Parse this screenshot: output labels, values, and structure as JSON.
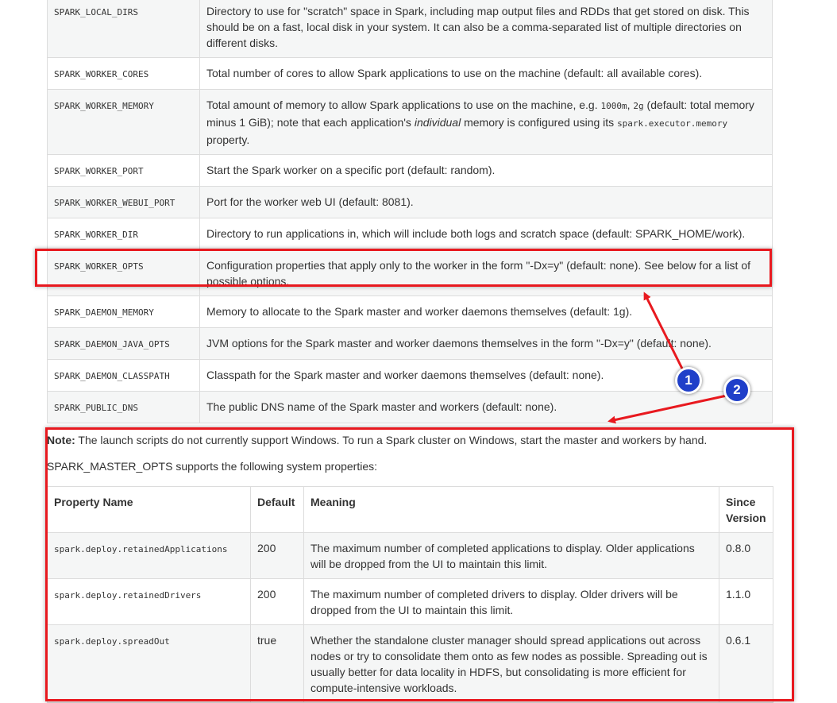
{
  "env_rows": [
    {
      "name": "SPARK_LOCAL_DIRS",
      "desc": [
        "Directory to use for \"scratch\" space in Spark, including map output files and RDDs that get stored on disk. This should be on a fast, local disk in your system. It can also be a comma-separated list of multiple directories on different disks."
      ]
    },
    {
      "name": "SPARK_WORKER_CORES",
      "desc": [
        "Total number of cores to allow Spark applications to use on the machine (default: all available cores)."
      ]
    },
    {
      "name": "SPARK_WORKER_MEMORY",
      "desc_parts": {
        "a": "Total amount of memory to allow Spark applications to use on the machine, e.g. ",
        "code1": "1000m",
        "b": ", ",
        "code2": "2g",
        "c": " (default: total memory minus 1 GiB); note that each application's ",
        "em": "individual",
        "d": " memory is configured using its ",
        "code3": "spark.executor.memory",
        "e": " property."
      }
    },
    {
      "name": "SPARK_WORKER_PORT",
      "desc": [
        "Start the Spark worker on a specific port (default: random)."
      ]
    },
    {
      "name": "SPARK_WORKER_WEBUI_PORT",
      "desc": [
        "Port for the worker web UI (default: 8081)."
      ]
    },
    {
      "name": "SPARK_WORKER_DIR",
      "desc": [
        "Directory to run applications in, which will include both logs and scratch space (default: SPARK_HOME/work)."
      ]
    },
    {
      "name": "SPARK_WORKER_OPTS",
      "desc": [
        "Configuration properties that apply only to the worker in the form \"-Dx=y\" (default: none). See below for a list of possible options."
      ]
    },
    {
      "name": "SPARK_DAEMON_MEMORY",
      "desc": [
        "Memory to allocate to the Spark master and worker daemons themselves (default: 1g)."
      ]
    },
    {
      "name": "SPARK_DAEMON_JAVA_OPTS",
      "desc": [
        "JVM options for the Spark master and worker daemons themselves in the form \"-Dx=y\" (default: none)."
      ]
    },
    {
      "name": "SPARK_DAEMON_CLASSPATH",
      "desc": [
        "Classpath for the Spark master and worker daemons themselves (default: none)."
      ]
    },
    {
      "name": "SPARK_PUBLIC_DNS",
      "desc": [
        "The public DNS name of the Spark master and workers (default: none)."
      ]
    }
  ],
  "note": {
    "label": "Note:",
    "text": " The launch scripts do not currently support Windows. To run a Spark cluster on Windows, start the master and workers by hand."
  },
  "master_opts_intro": "SPARK_MASTER_OPTS supports the following system properties:",
  "props_table": {
    "headers": {
      "name": "Property Name",
      "default": "Default",
      "meaning": "Meaning",
      "since": "Since Version"
    },
    "rows": [
      {
        "name": "spark.deploy.retainedApplications",
        "default": "200",
        "meaning": "The maximum number of completed applications to display. Older applications will be dropped from the UI to maintain this limit.",
        "since": "0.8.0"
      },
      {
        "name": "spark.deploy.retainedDrivers",
        "default": "200",
        "meaning": "The maximum number of completed drivers to display. Older drivers will be dropped from the UI to maintain this limit.",
        "since": "1.1.0"
      },
      {
        "name": "spark.deploy.spreadOut",
        "default": "true",
        "meaning": "Whether the standalone cluster manager should spread applications out across nodes or try to consolidate them onto as few nodes as possible. Spreading out is usually better for data locality in HDFS, but consolidating is more efficient for compute-intensive workloads.",
        "since": "0.6.1"
      }
    ]
  },
  "annotations": {
    "badge_1": "1",
    "badge_2": "2",
    "box_color": "#e8191f",
    "badge_color": "#1f3fc9"
  }
}
